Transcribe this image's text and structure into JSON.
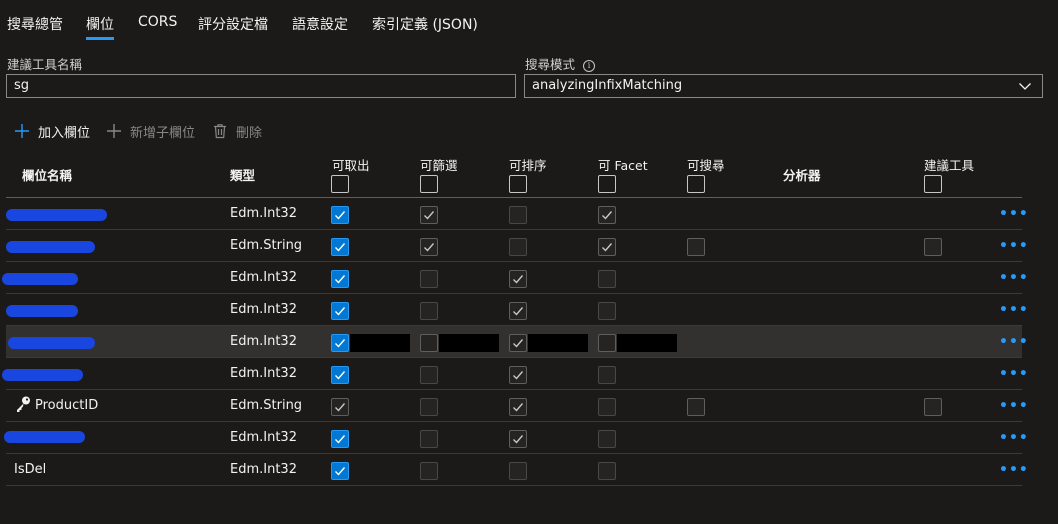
{
  "tabs": [
    "搜尋總管",
    "欄位",
    "CORS",
    "評分設定檔",
    "語意設定",
    "索引定義 (JSON)"
  ],
  "active_tab": "欄位",
  "suggester": {
    "name_label": "建議工具名稱",
    "name_value": "sg",
    "mode_label": "搜尋模式",
    "mode_value": "analyzingInfixMatching"
  },
  "commands": {
    "add_field": "加入欄位",
    "add_subfield": "新增子欄位",
    "delete": "刪除"
  },
  "columns": {
    "name": "欄位名稱",
    "type": "類型",
    "retrievable": "可取出",
    "filterable": "可篩選",
    "sortable": "可排序",
    "facetable": "可 Facet",
    "searchable": "可搜尋",
    "analyzer": "分析器",
    "suggester": "建議工具"
  },
  "rows": [
    {
      "name": "",
      "type": "Edm.Int32"
    },
    {
      "name": "",
      "type": "Edm.String"
    },
    {
      "name": "",
      "type": "Edm.Int32"
    },
    {
      "name": "",
      "type": "Edm.Int32"
    },
    {
      "name": "",
      "type": "Edm.Int32"
    },
    {
      "name": "",
      "type": "Edm.Int32"
    },
    {
      "name": "ProductID",
      "type": "Edm.String",
      "key": true
    },
    {
      "name": "",
      "type": "Edm.Int32"
    },
    {
      "name": "IsDel",
      "type": "Edm.Int32"
    }
  ],
  "more_glyph": "•••",
  "colors": {
    "background": "#1b1a19",
    "accent": "#0078d4",
    "link": "#2899f5",
    "redaction": "#1a46e0"
  }
}
